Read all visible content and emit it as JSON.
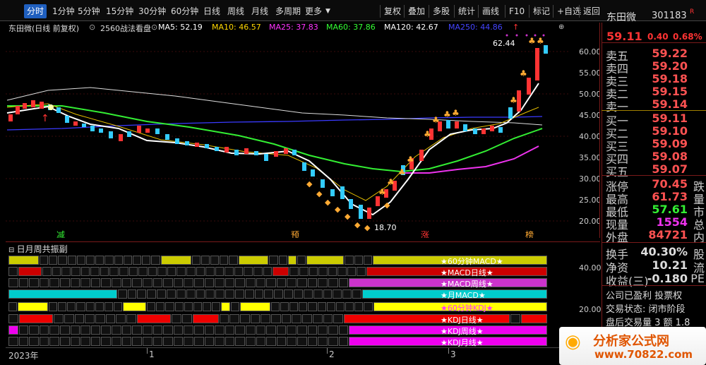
{
  "toolbar": {
    "tabs": [
      "分时",
      "1分钟",
      "5分钟",
      "15分钟",
      "30分钟",
      "60分钟",
      "日线",
      "周线",
      "月线",
      "多周期",
      "更多"
    ],
    "tools": [
      "复权",
      "叠加",
      "多股",
      "统计",
      "画线",
      "F10",
      "标记",
      "+自选",
      "返回"
    ]
  },
  "chart": {
    "stock_label": "东田微(日线 前复权)",
    "indicator_name": "2560战法看盘",
    "ma5": "MA5: 52.19",
    "ma10": "MA10: 46.57",
    "ma25": "MA25: 37.83",
    "ma60": "MA60: 37.86",
    "ma120": "MA120: 42.67",
    "ma250": "MA250: 44.86",
    "high_mark": "62.44",
    "low_mark": "18.70",
    "yticks": [
      "60.00",
      "55.00",
      "50.00",
      "45.00",
      "40.00",
      "35.00",
      "30.00",
      "25.00",
      "20.00"
    ],
    "signals": [
      "减",
      "预",
      "涨",
      "榜"
    ],
    "colors": {
      "ma5": "#ffffff",
      "ma10": "#ffd700",
      "ma25": "#ff33ff",
      "ma60": "#33ff33",
      "ma120": "#ffffff",
      "ma250": "#4444ff",
      "up": "#ff3333",
      "down": "#33ccff"
    }
  },
  "indicator": {
    "title": "日月周共振副",
    "yticks": [
      "40.00",
      "20.00"
    ],
    "rows": [
      {
        "label": "★60分钟MACD★",
        "color": "#cccc00"
      },
      {
        "label": "★MACD日线★",
        "color": "#dd0000"
      },
      {
        "label": "★MACD周线★",
        "color": "#cc33cc"
      },
      {
        "label": "★月MACD★",
        "color": "#00cccc"
      },
      {
        "label": "★60分钟KDJ★",
        "color": "#ffff00"
      },
      {
        "label": "★KDJ日线★",
        "color": "#ee0000"
      },
      {
        "label": "★KDJ周线★",
        "color": "#ee00ee"
      },
      {
        "label": "★KDJ月线★",
        "color": "#ee00ee"
      }
    ]
  },
  "xaxis": {
    "labels": [
      "2023年",
      "1",
      "2",
      "3"
    ]
  },
  "quote": {
    "name": "东田微",
    "code": "301183",
    "flag": "R",
    "price": "59.11",
    "change": "0.40",
    "pct": "0.68%",
    "asks": [
      {
        "label": "卖五",
        "value": "59.22"
      },
      {
        "label": "卖四",
        "value": "59.20"
      },
      {
        "label": "卖三",
        "value": "59.18"
      },
      {
        "label": "卖二",
        "value": "59.15"
      },
      {
        "label": "卖一",
        "value": "59.14"
      }
    ],
    "bids": [
      {
        "label": "买一",
        "value": "59.11"
      },
      {
        "label": "买二",
        "value": "59.10"
      },
      {
        "label": "买三",
        "value": "59.09"
      },
      {
        "label": "买四",
        "value": "59.08"
      },
      {
        "label": "买五",
        "value": "59.07"
      }
    ],
    "stats": [
      {
        "label": "涨停",
        "value": "70.45",
        "cut": "跌"
      },
      {
        "label": "最高",
        "value": "61.73",
        "cut": "量"
      },
      {
        "label": "最低",
        "value": "57.61",
        "cut": "市"
      },
      {
        "label": "现量",
        "value": "1554",
        "cut": "总"
      },
      {
        "label": "外盘",
        "value": "84721",
        "cut": "内"
      }
    ],
    "extra": [
      {
        "label": "换手",
        "value": "40.30%",
        "cut": "股"
      },
      {
        "label": "净资",
        "value": "10.21",
        "cut": "流"
      },
      {
        "label": "收益(三)",
        "value": "-0.180",
        "cut": "PE"
      }
    ],
    "notes": [
      "公司已盈利 投票权",
      "交易状态: 闭市阶段",
      "盘后交易量 3 额 1.8"
    ]
  },
  "watermark": "分析家公式网 www.70822.com",
  "logo": {
    "title": "分析家公式网",
    "url": "www.70822.com"
  }
}
